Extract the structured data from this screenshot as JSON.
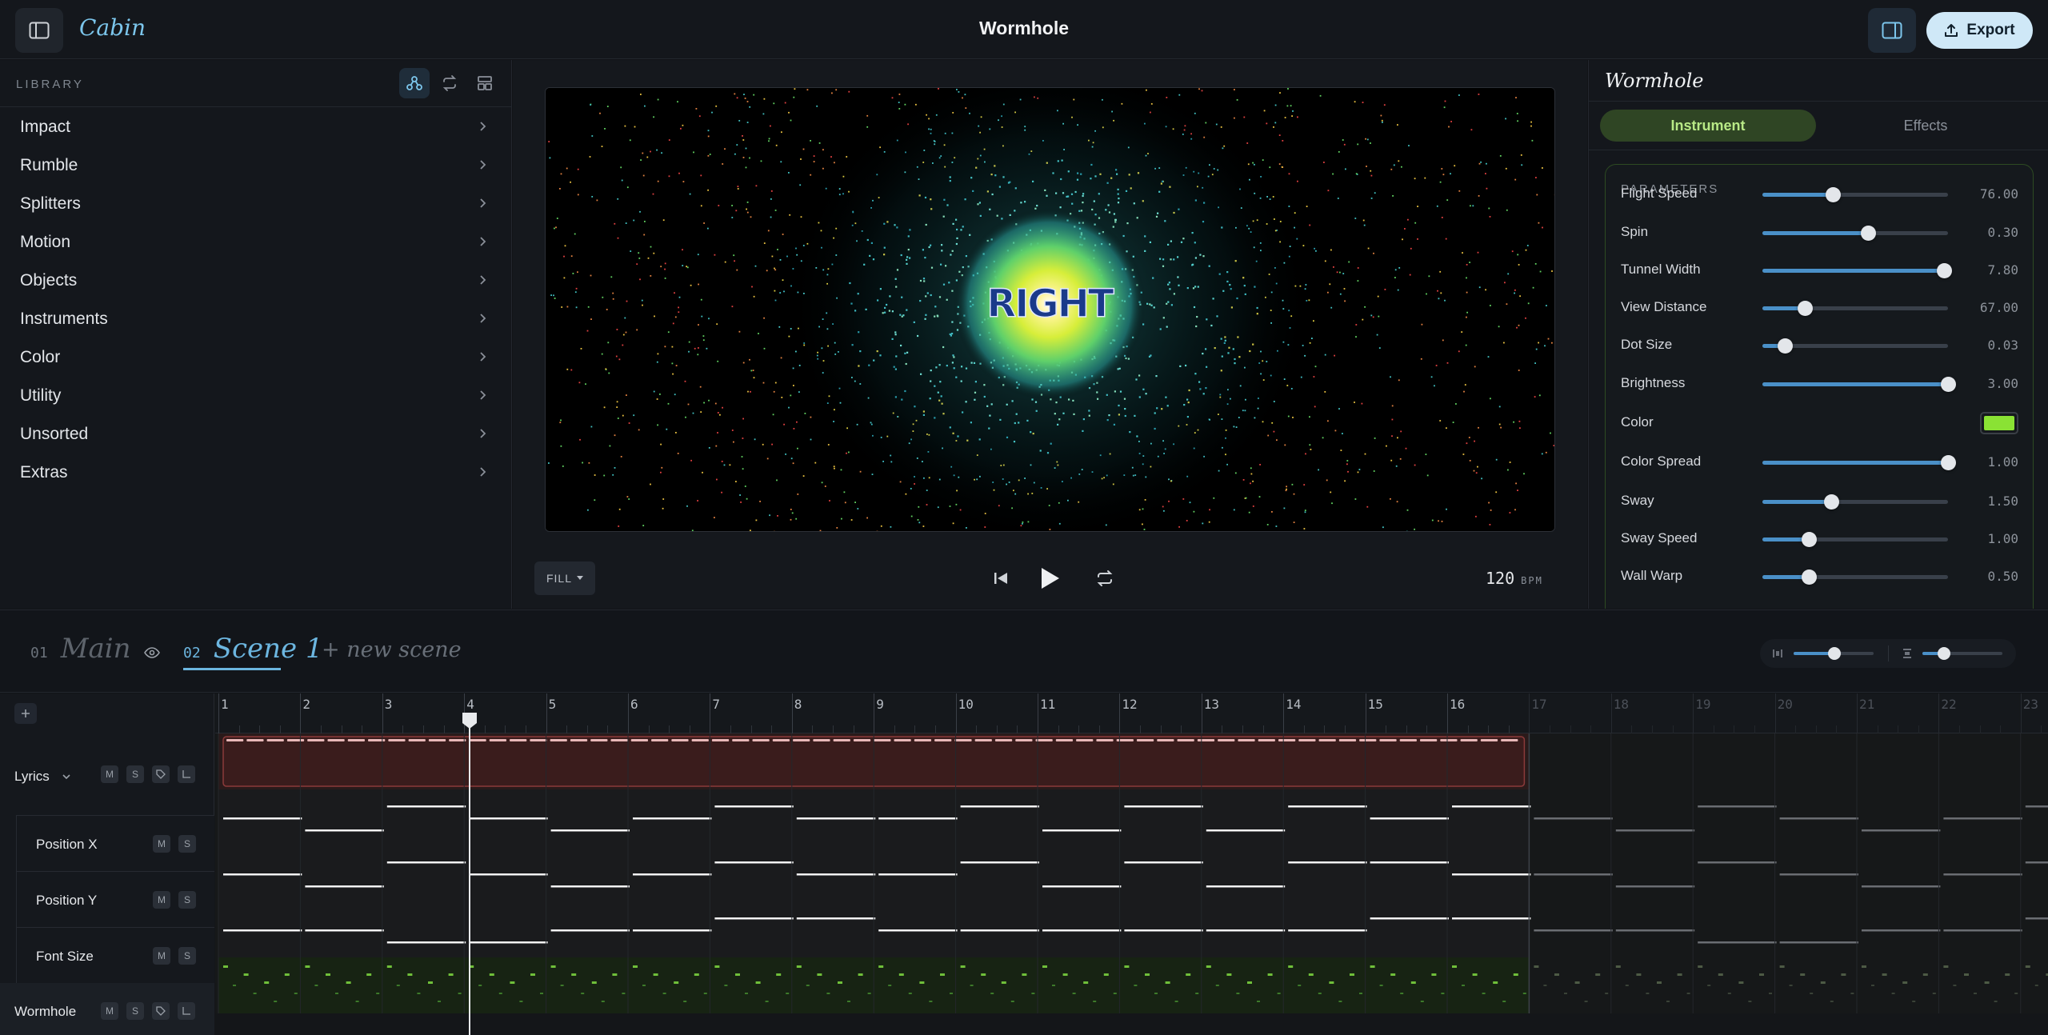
{
  "app": {
    "brand": "Cabin",
    "title": "Wormhole",
    "export_label": "Export"
  },
  "library": {
    "title": "LIBRARY",
    "items": [
      {
        "label": "Impact"
      },
      {
        "label": "Rumble"
      },
      {
        "label": "Splitters"
      },
      {
        "label": "Motion"
      },
      {
        "label": "Objects"
      },
      {
        "label": "Instruments"
      },
      {
        "label": "Color"
      },
      {
        "label": "Utility"
      },
      {
        "label": "Unsorted"
      },
      {
        "label": "Extras"
      }
    ]
  },
  "preview": {
    "overlay_text": "RIGHT",
    "fill_label": "FILL",
    "bpm": "120",
    "bpm_unit": "BPM"
  },
  "panel": {
    "title": "Wormhole",
    "tabs": {
      "instrument": "Instrument",
      "effects": "Effects"
    },
    "params_title": "PARAMETERS",
    "params": [
      {
        "label": "Flight Speed",
        "value": "76.00",
        "fraction": 0.38
      },
      {
        "label": "Spin",
        "value": "0.30",
        "fraction": 0.57
      },
      {
        "label": "Tunnel Width",
        "value": "7.80",
        "fraction": 0.98
      },
      {
        "label": "View Distance",
        "value": "67.00",
        "fraction": 0.23
      },
      {
        "label": "Dot Size",
        "value": "0.03",
        "fraction": 0.12
      },
      {
        "label": "Brightness",
        "value": "3.00",
        "fraction": 1.0
      },
      {
        "label": "Color",
        "color": "#8ae234"
      },
      {
        "label": "Color Spread",
        "value": "1.00",
        "fraction": 1.0
      },
      {
        "label": "Sway",
        "value": "1.50",
        "fraction": 0.37
      },
      {
        "label": "Sway Speed",
        "value": "1.00",
        "fraction": 0.25
      },
      {
        "label": "Wall Warp",
        "value": "0.50",
        "fraction": 0.25
      }
    ]
  },
  "scenes": [
    {
      "num": "01",
      "name": "Main"
    },
    {
      "num": "02",
      "name": "Scene 1"
    }
  ],
  "new_scene_label": "+ new scene",
  "timeline": {
    "bars": [
      "1",
      "2",
      "3",
      "4",
      "5",
      "6",
      "7",
      "8",
      "9",
      "10",
      "11",
      "12",
      "13",
      "14",
      "15",
      "16",
      "17",
      "18",
      "19",
      "20",
      "21",
      "22",
      "23"
    ],
    "active_bars": 16,
    "tracks": [
      {
        "name": "Lyrics",
        "badges": [
          "M",
          "S"
        ]
      },
      {
        "name": "Position X",
        "badges": [
          "M",
          "S"
        ]
      },
      {
        "name": "Position Y",
        "badges": [
          "M",
          "S"
        ]
      },
      {
        "name": "Font Size",
        "badges": [
          "M",
          "S"
        ]
      },
      {
        "name": "Wormhole",
        "badges": [
          "M",
          "S"
        ]
      }
    ],
    "automation": {
      "position_x": [
        0.5,
        0.2,
        0.8,
        0.5,
        0.2,
        0.5,
        0.8,
        0.5,
        0.5,
        0.8,
        0.2,
        0.8,
        0.2,
        0.8,
        0.5,
        0.8
      ],
      "position_y": [
        0.5,
        0.2,
        0.8,
        0.5,
        0.2,
        0.5,
        0.8,
        0.5,
        0.5,
        0.8,
        0.2,
        0.8,
        0.2,
        0.8,
        0.8,
        0.5
      ],
      "font_size": [
        0.5,
        0.5,
        0.2,
        0.2,
        0.5,
        0.5,
        0.8,
        0.8,
        0.5,
        0.5,
        0.5,
        0.5,
        0.5,
        0.5,
        0.8,
        0.8
      ]
    }
  }
}
